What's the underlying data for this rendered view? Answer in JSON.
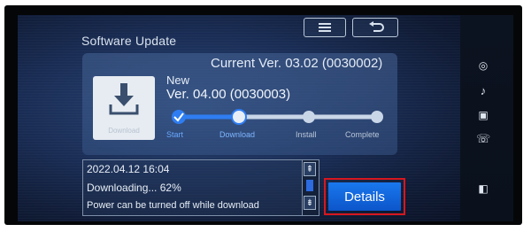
{
  "header": {
    "title": "Software Update",
    "menu_icon": "menu-icon",
    "back_icon": "back-icon"
  },
  "update": {
    "current_version": "Current Ver. 03.02 (0030002)",
    "new_label": "New",
    "new_version": "Ver. 04.00 (0030003)",
    "download_caption": "Download",
    "download_icon": "download-arrow-icon"
  },
  "progress": {
    "steps": [
      {
        "label": "Start",
        "state": "done"
      },
      {
        "label": "Download",
        "state": "active"
      },
      {
        "label": "Install",
        "state": "pending"
      },
      {
        "label": "Complete",
        "state": "pending"
      }
    ],
    "active_color": "#2f7df2",
    "pending_color": "#c9d6e8"
  },
  "log": {
    "date": "2022.04.12 16:04",
    "progress_text": "Downloading...  62%",
    "note": "Power can be turned off while download"
  },
  "actions": {
    "details_label": "Details",
    "highlight_color": "#d7171f"
  },
  "side_icons": [
    "navigation-icon",
    "music-icon",
    "photo-icon",
    "phone-icon",
    "screen-icon"
  ]
}
